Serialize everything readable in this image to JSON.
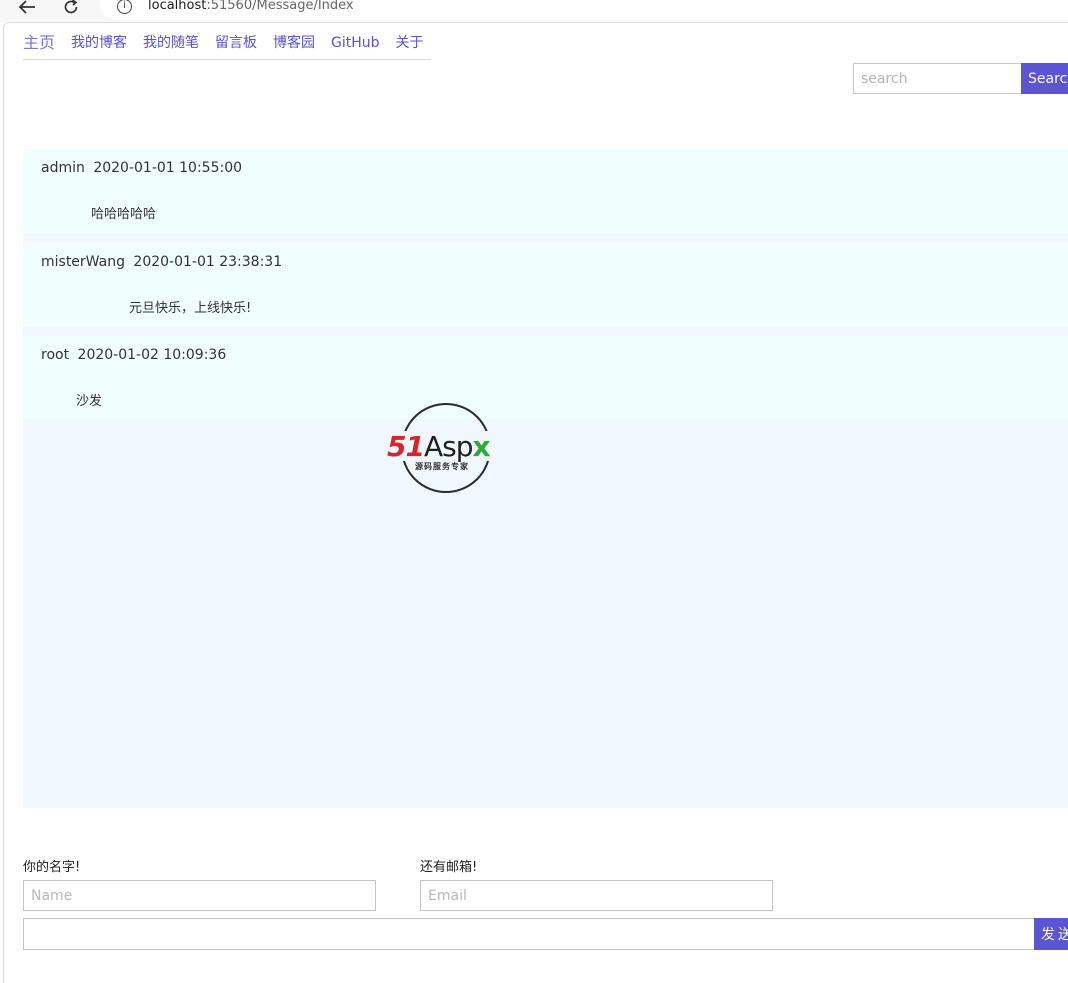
{
  "browser": {
    "url_host": "localhost",
    "url_rest": ":51560/Message/Index"
  },
  "nav": {
    "items": [
      {
        "label": "主页"
      },
      {
        "label": "我的博客"
      },
      {
        "label": "我的随笔"
      },
      {
        "label": "留言板"
      },
      {
        "label": "博客园"
      },
      {
        "label": "GitHub"
      },
      {
        "label": "关于"
      }
    ]
  },
  "search": {
    "placeholder": "search",
    "button_label": "Search"
  },
  "messages": [
    {
      "user": "admin",
      "time": "2020-01-01 10:55:00",
      "content": "哈哈哈哈哈"
    },
    {
      "user": "misterWang",
      "time": "2020-01-01 23:38:31",
      "content": "元旦快乐，上线快乐!"
    },
    {
      "user": "root",
      "time": "2020-01-02 10:09:36",
      "content": "沙发"
    }
  ],
  "watermark": {
    "brand_num": "51",
    "brand_asp": "Asp",
    "brand_x": "x",
    "tagline": "源码服务专家"
  },
  "form": {
    "name_label": "你的名字!",
    "name_placeholder": "Name",
    "email_label": "还有邮箱!",
    "email_placeholder": "Email",
    "message_placeholder": "",
    "send_label": "发送"
  },
  "colors": {
    "accent": "#5b54d4",
    "board_bg": "#f0f7fe",
    "message_bg": "#f0fefe"
  }
}
